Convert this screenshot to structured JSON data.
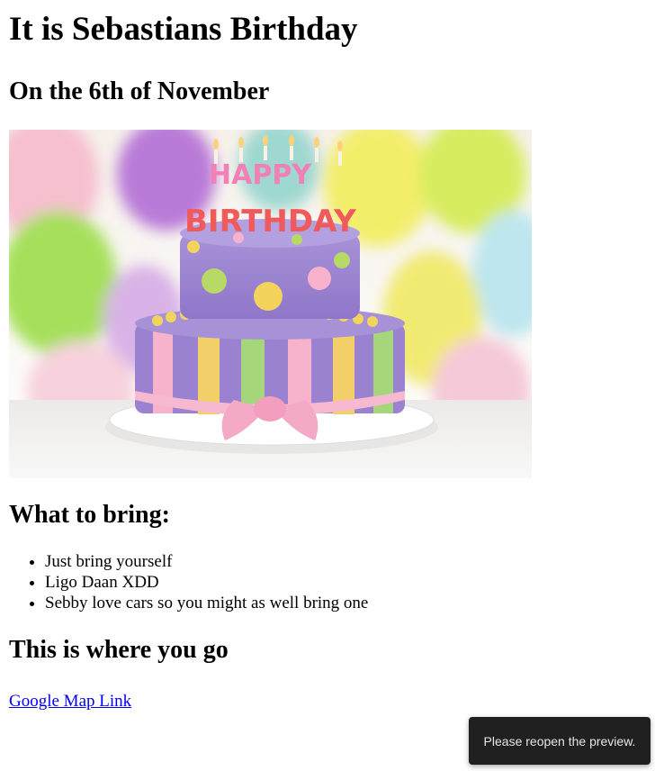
{
  "page": {
    "title": "It is Sebastians Birthday",
    "date_heading": "On the 6th of November",
    "image": {
      "cake_text_top": "HAPPY",
      "cake_text_bottom": "BIRTHDAY"
    },
    "bring_heading": "What to bring:",
    "bring_items": [
      "Just bring yourself",
      "Ligo Daan XDD",
      "Sebby love cars so you might as well bring one"
    ],
    "where_heading": "This is where you go",
    "map_link_label": "Google Map Link"
  },
  "toast": {
    "message": "Please reopen the preview."
  },
  "colors": {
    "link": "#0000ee",
    "toast_bg": "#202020",
    "toast_text": "#e6e6e6"
  }
}
